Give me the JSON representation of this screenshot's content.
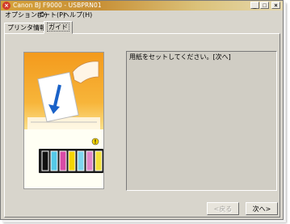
{
  "window": {
    "title": "Canon BJ F9000 - USBPRN01",
    "app_icon": "canon-printer-icon",
    "controls": {
      "minimize": "_",
      "maximize": "□",
      "close": "×"
    }
  },
  "menu": {
    "items": [
      "オプション(O)",
      "ポート(P)",
      "ヘルプ(H)"
    ]
  },
  "tabs": [
    {
      "label": "プリンタ情報",
      "active": false
    },
    {
      "label": "ガイド",
      "active": true
    }
  ],
  "guide": {
    "message": "用紙をセットしてください。[次へ]",
    "illustration": "load-paper-illustration",
    "ink_cartridges": [
      "#111111",
      "#55c9e8",
      "#d84ba6",
      "#f4d400",
      "#7fd6ee",
      "#e286c8",
      "#f3e03a"
    ],
    "ink_warning_slot": 6,
    "colors": {
      "illustration_top": "#f6b024",
      "illustration_bottom": "#fffff4",
      "arrow": "#1a62c8"
    }
  },
  "buttons": {
    "back": "<戻る",
    "next": "次へ>"
  }
}
